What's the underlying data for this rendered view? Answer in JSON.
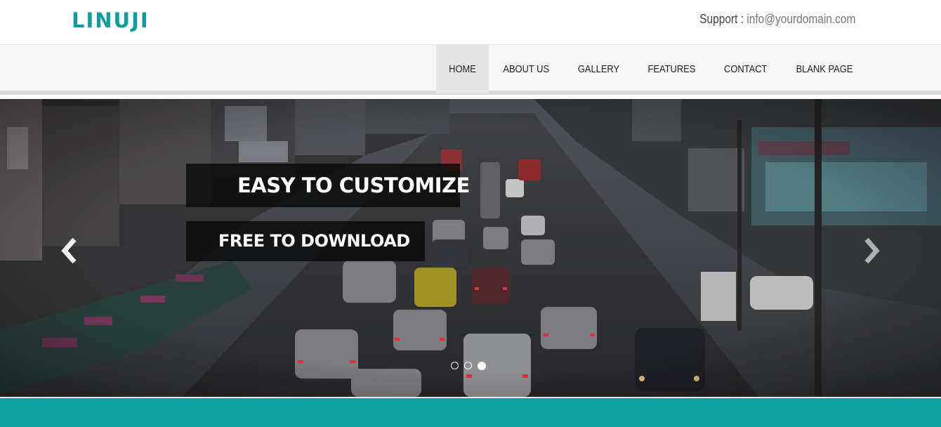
{
  "header": {
    "logo": "LINUJI",
    "support_label": "Support :",
    "support_email": "info@yourdomain.com"
  },
  "nav": {
    "items": [
      {
        "label": "HOME",
        "active": true
      },
      {
        "label": "ABOUT US"
      },
      {
        "label": "GALLERY"
      },
      {
        "label": "FEATURES"
      },
      {
        "label": "CONTACT"
      },
      {
        "label": "BLANK PAGE"
      }
    ]
  },
  "slider": {
    "caption_title": "EASY TO CUSTOMIZE",
    "caption_subtitle": "FREE TO DOWNLOAD",
    "prev_icon": "chevron-left-icon",
    "next_icon": "chevron-right-icon",
    "indicator_count": 3,
    "active_indicator": 3
  },
  "colors": {
    "brand": "#0f9c9c",
    "band": "#0d9fa0",
    "nav_bg": "#f6f6f6"
  }
}
